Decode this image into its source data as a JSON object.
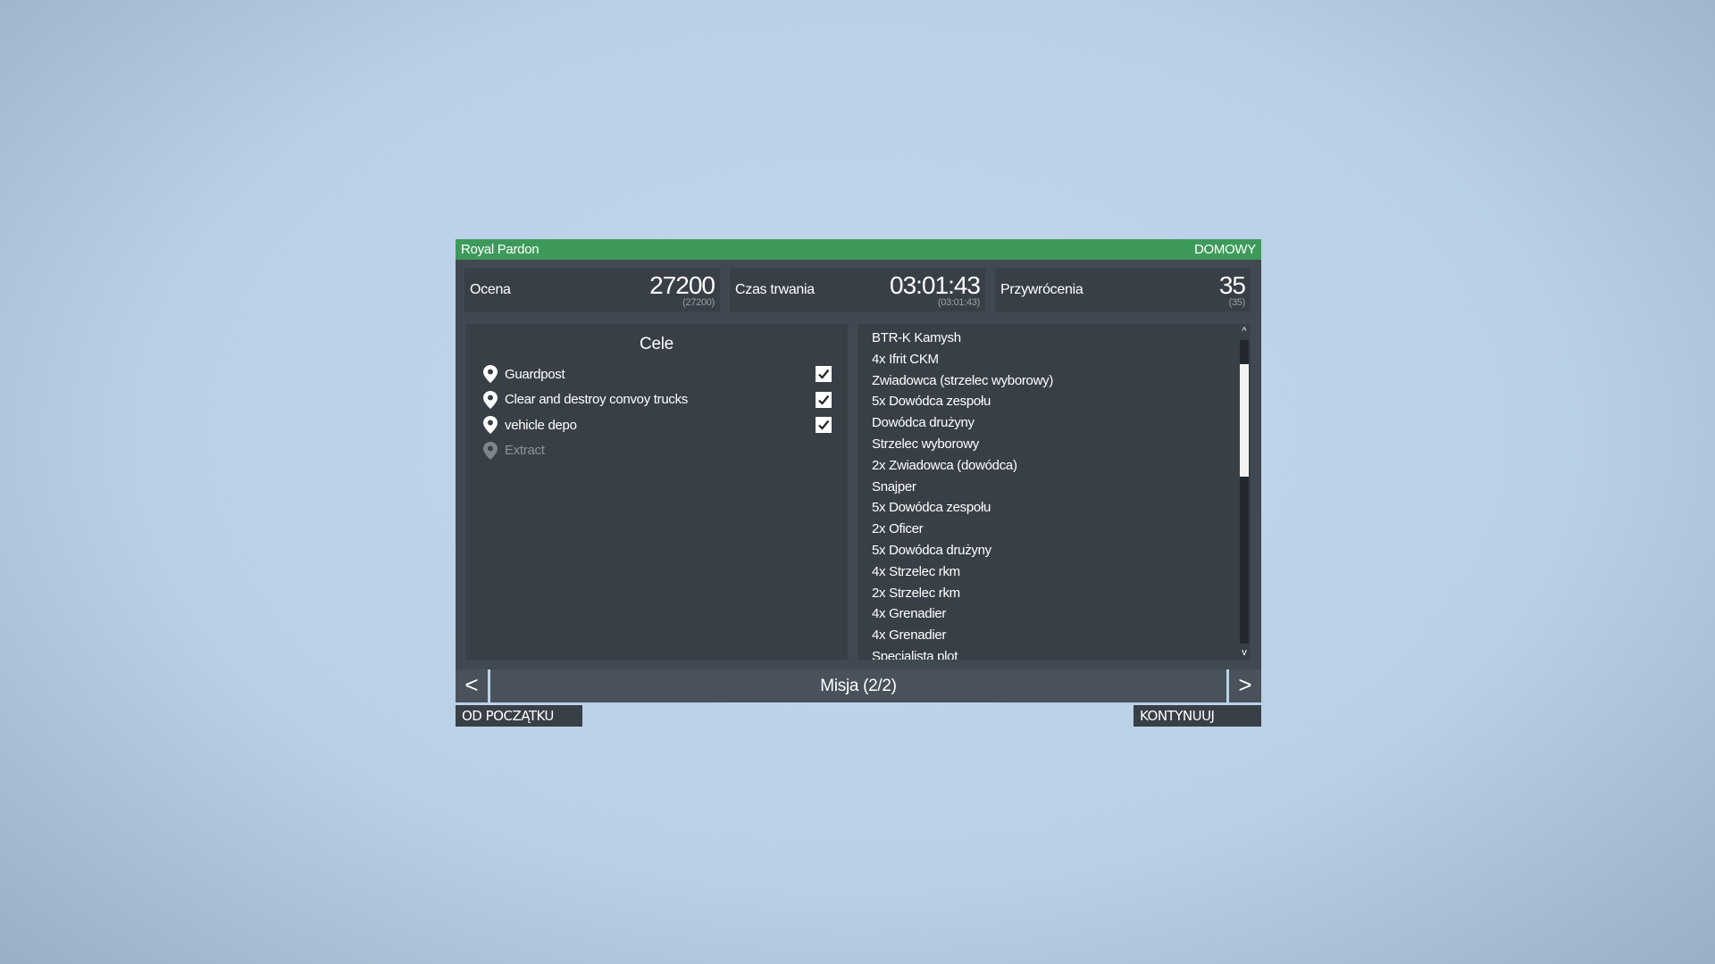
{
  "header": {
    "title": "Royal Pardon",
    "mode": "DOMOWY"
  },
  "stats": {
    "score": {
      "label": "Ocena",
      "value": "27200",
      "sub": "(27200)"
    },
    "duration": {
      "label": "Czas trwania",
      "value": "03:01:43",
      "sub": "(03:01:43)"
    },
    "respawns": {
      "label": "Przywrócenia",
      "value": "35",
      "sub": "(35)"
    }
  },
  "objectives": {
    "title": "Cele",
    "items": [
      {
        "label": "Guardpost",
        "completed": true
      },
      {
        "label": "Clear and destroy convoy trucks",
        "completed": true
      },
      {
        "label": "vehicle depo",
        "completed": true
      },
      {
        "label": "Extract",
        "completed": false
      }
    ]
  },
  "units": [
    "BTR-K Kamysh",
    "4x Ifrit CKM",
    "Zwiadowca (strzelec wyborowy)",
    "5x Dowódca zespołu",
    "Dowódca drużyny",
    "Strzelec wyborowy",
    "2x Zwiadowca (dowódca)",
    "Snajper",
    "5x Dowódca zespołu",
    "2x Oficer",
    "5x Dowódca drużyny",
    "4x Strzelec rkm",
    "2x Strzelec rkm",
    "4x Grenadier",
    "4x Grenadier",
    "Specjalista plot"
  ],
  "scroll": {
    "up_glyph": "^",
    "down_glyph": "v",
    "position_fraction": 0.08,
    "visible_fraction": 0.37
  },
  "nav": {
    "prev": "<",
    "next": ">",
    "label": "Misja (2/2)"
  },
  "actions": {
    "restart": "OD POCZĄTKU",
    "continue": "KONTYNUUJ"
  },
  "colors": {
    "titlebar": "#3d9a5a",
    "panel": "#404851",
    "subpanel": "#383f47"
  },
  "icons": {
    "objective": "map-pin-icon",
    "check": "checkbox-checked-icon"
  }
}
